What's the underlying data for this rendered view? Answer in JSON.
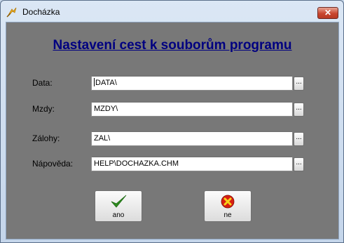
{
  "window": {
    "title": "Docházka",
    "close_label": "✕"
  },
  "heading": "Nastavení cest k souborům programu",
  "fields": [
    {
      "label": "Data:",
      "value": "DATA\\"
    },
    {
      "label": "Mzdy:",
      "value": "MZDY\\"
    },
    {
      "label": "Zálohy:",
      "value": "ZAL\\"
    },
    {
      "label": "Nápověda:",
      "value": "HELP\\DOCHAZKA.CHM"
    }
  ],
  "browse_label": "...",
  "buttons": {
    "ok_label": "ano",
    "cancel_label": "ne"
  },
  "colors": {
    "client_bg": "#787878",
    "heading": "#000080",
    "ok_icon": "#2e8b1f",
    "cancel_icon": "#d81e12"
  },
  "icons": {
    "app": "app-icon",
    "ok": "checkmark-icon",
    "cancel": "cancel-icon"
  }
}
